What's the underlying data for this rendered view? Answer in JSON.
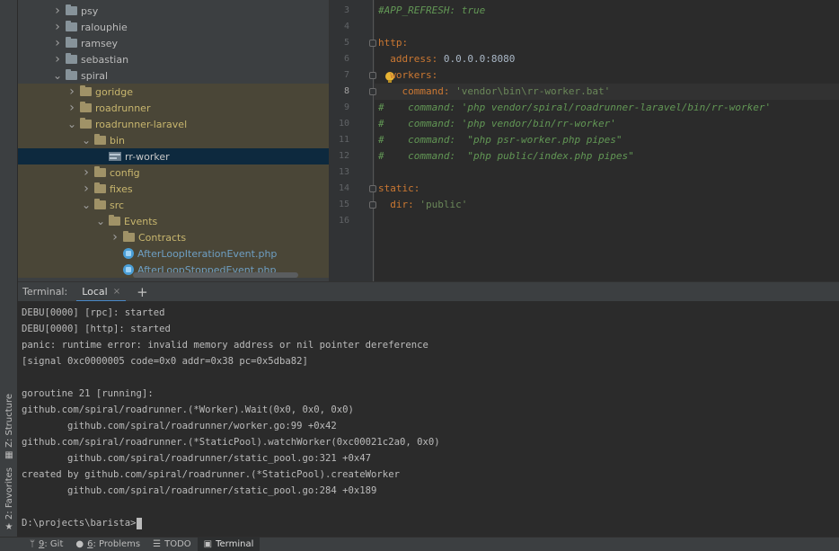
{
  "left_strip": {
    "structure_label": "Z: Structure",
    "favorites_label": "2: Favorites"
  },
  "project_tree": {
    "items": [
      {
        "label": "psy",
        "depth": 0,
        "expanded": false,
        "excluded": false
      },
      {
        "label": "ralouphie",
        "depth": 0,
        "expanded": false,
        "excluded": false
      },
      {
        "label": "ramsey",
        "depth": 0,
        "expanded": false,
        "excluded": false
      },
      {
        "label": "sebastian",
        "depth": 0,
        "expanded": false,
        "excluded": false
      },
      {
        "label": "spiral",
        "depth": 0,
        "expanded": true,
        "excluded": false
      },
      {
        "label": "goridge",
        "depth": 1,
        "expanded": false,
        "excluded": true
      },
      {
        "label": "roadrunner",
        "depth": 1,
        "expanded": false,
        "excluded": true
      },
      {
        "label": "roadrunner-laravel",
        "depth": 1,
        "expanded": true,
        "excluded": true
      },
      {
        "label": "bin",
        "depth": 2,
        "expanded": true,
        "excluded": true
      },
      {
        "label": "rr-worker",
        "depth": 3,
        "file": true,
        "selected": true
      },
      {
        "label": "config",
        "depth": 2,
        "expanded": false,
        "excluded": true
      },
      {
        "label": "fixes",
        "depth": 2,
        "expanded": false,
        "excluded": true
      },
      {
        "label": "src",
        "depth": 2,
        "expanded": true,
        "excluded": true
      },
      {
        "label": "Events",
        "depth": 3,
        "expanded": true,
        "excluded": true
      },
      {
        "label": "Contracts",
        "depth": 4,
        "expanded": false,
        "excluded": true
      },
      {
        "label": "AfterLoopIterationEvent.php",
        "depth": 4,
        "php": true,
        "excluded": true
      },
      {
        "label": "AfterLoopStoppedEvent.php",
        "depth": 4,
        "php": true,
        "excluded": true
      }
    ]
  },
  "editor": {
    "current_line": 8,
    "lines": [
      {
        "n": "3",
        "parts": [
          {
            "t": "#APP_REFRESH: true",
            "c": "comment"
          }
        ]
      },
      {
        "n": "4",
        "parts": []
      },
      {
        "n": "5",
        "parts": [
          {
            "t": "http:",
            "c": "key"
          }
        ]
      },
      {
        "n": "6",
        "parts": [
          {
            "t": "  address: ",
            "c": "key"
          },
          {
            "t": "0.0.0.0:8080",
            "c": "val"
          }
        ]
      },
      {
        "n": "7",
        "parts": [
          {
            "t": "  workers:",
            "c": "key"
          }
        ]
      },
      {
        "n": "8",
        "parts": [
          {
            "t": "    command: ",
            "c": "key"
          },
          {
            "t": "'vendor\\bin\\rr-worker.bat'",
            "c": "str"
          }
        ]
      },
      {
        "n": "9",
        "parts": [
          {
            "t": "#    command: 'php vendor/spiral/roadrunner-laravel/bin/rr-worker'",
            "c": "comment"
          }
        ]
      },
      {
        "n": "10",
        "parts": [
          {
            "t": "#    command: 'php vendor/bin/rr-worker'",
            "c": "comment"
          }
        ]
      },
      {
        "n": "11",
        "parts": [
          {
            "t": "#    command:  \"php psr-worker.php pipes\"",
            "c": "comment"
          }
        ]
      },
      {
        "n": "12",
        "parts": [
          {
            "t": "#    command:  \"php public/index.php pipes\"",
            "c": "comment"
          }
        ]
      },
      {
        "n": "13",
        "parts": []
      },
      {
        "n": "14",
        "parts": [
          {
            "t": "static:",
            "c": "key"
          }
        ]
      },
      {
        "n": "15",
        "parts": [
          {
            "t": "  dir: ",
            "c": "key"
          },
          {
            "t": "'public'",
            "c": "str"
          }
        ]
      },
      {
        "n": "16",
        "parts": []
      }
    ]
  },
  "terminal": {
    "title": "Terminal:",
    "tab_label": "Local",
    "close_glyph": "×",
    "add_glyph": "+",
    "lines": [
      "DEBU[0000] [rpc]: started",
      "DEBU[0000] [http]: started",
      "panic: runtime error: invalid memory address or nil pointer dereference",
      "[signal 0xc0000005 code=0x0 addr=0x38 pc=0x5dba82]",
      "",
      "goroutine 21 [running]:",
      "github.com/spiral/roadrunner.(*Worker).Wait(0x0, 0x0, 0x0)",
      "        github.com/spiral/roadrunner/worker.go:99 +0x42",
      "github.com/spiral/roadrunner.(*StaticPool).watchWorker(0xc00021c2a0, 0x0)",
      "        github.com/spiral/roadrunner/static_pool.go:321 +0x47",
      "created by github.com/spiral/roadrunner.(*StaticPool).createWorker",
      "        github.com/spiral/roadrunner/static_pool.go:284 +0x189",
      ""
    ],
    "prompt": "D:\\projects\\barista>"
  },
  "bottom_bar": {
    "git": {
      "mnemonic": "9",
      "label": ": Git"
    },
    "problems": {
      "mnemonic": "6",
      "label": ": Problems"
    },
    "todo": {
      "label": "TODO"
    },
    "terminal": {
      "label": "Terminal"
    }
  }
}
